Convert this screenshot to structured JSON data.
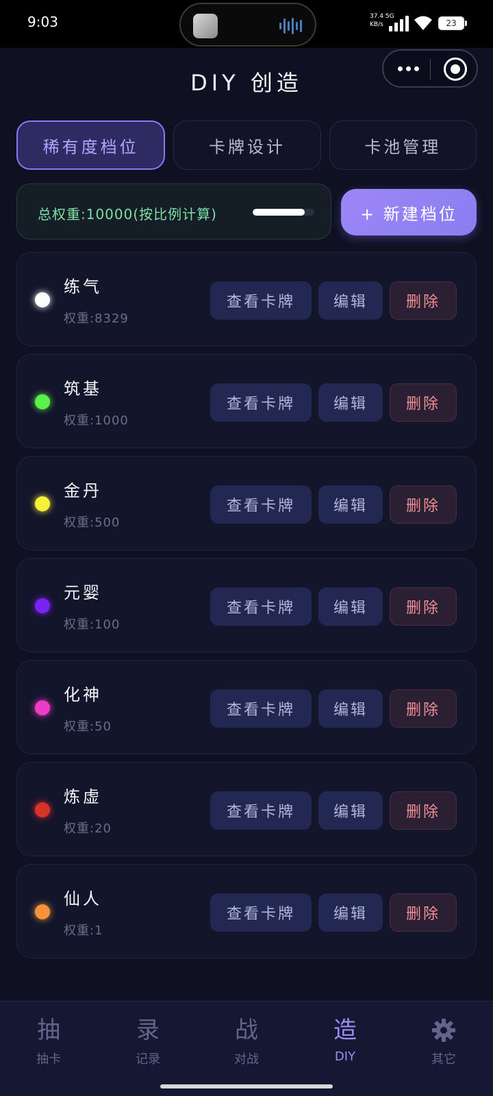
{
  "status_bar": {
    "time": "9:03",
    "net_speed_value": "37.4",
    "net_speed_unit": "KB/s",
    "network": "5G",
    "battery": "23"
  },
  "header": {
    "title": "DIY 创造"
  },
  "tabs": [
    {
      "label": "稀有度档位",
      "active": true
    },
    {
      "label": "卡牌设计",
      "active": false
    },
    {
      "label": "卡池管理",
      "active": false
    }
  ],
  "weight_summary": {
    "text": "总权重:10000(按比例计算)",
    "progress": 0.84
  },
  "new_tier_button": "+ 新建档位",
  "tiers": [
    {
      "name": "练气",
      "weight": "权重:8329",
      "color": "#ffffff"
    },
    {
      "name": "筑基",
      "weight": "权重:1000",
      "color": "#5cf04a"
    },
    {
      "name": "金丹",
      "weight": "权重:500",
      "color": "#f5f03a"
    },
    {
      "name": "元婴",
      "weight": "权重:100",
      "color": "#7a22f2"
    },
    {
      "name": "化神",
      "weight": "权重:50",
      "color": "#ec3cc8"
    },
    {
      "name": "炼虚",
      "weight": "权重:20",
      "color": "#d8322a"
    },
    {
      "name": "仙人",
      "weight": "权重:1",
      "color": "#f5943a"
    }
  ],
  "tier_actions": {
    "view": "查看卡牌",
    "edit": "编辑",
    "delete": "删除"
  },
  "bottom_nav": [
    {
      "glyph": "抽",
      "label": "抽卡",
      "active": false
    },
    {
      "glyph": "录",
      "label": "记录",
      "active": false
    },
    {
      "glyph": "战",
      "label": "对战",
      "active": false
    },
    {
      "glyph": "造",
      "label": "DIY",
      "active": true
    },
    {
      "icon": "gear-icon",
      "label": "其它",
      "active": false
    }
  ]
}
